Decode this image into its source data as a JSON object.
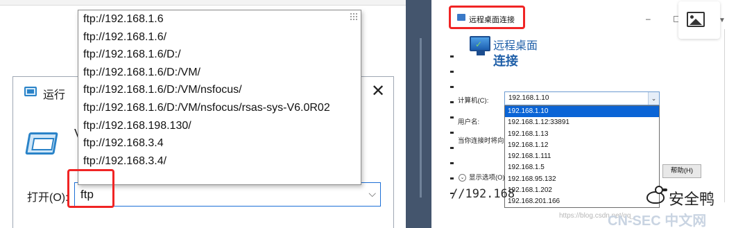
{
  "run_dialog": {
    "title": "运行",
    "close_glyph": "✕",
    "description_fragment": "V",
    "open_label": "打开(O):",
    "open_value": "ftp",
    "dropdown_glyph": "⌵",
    "history": [
      "ftp://192.168.1.6",
      "ftp://192.168.1.6/",
      "ftp://192.168.1.6/D:/",
      "ftp://192.168.1.6/D:/VM/",
      "ftp://192.168.1.6/D:/VM/nsfocus/",
      "ftp://192.168.1.6/D:/VM/nsfocus/rsas-sys-V6.0R02",
      "ftp://192.168.198.130/",
      "ftp://192.168.3.4",
      "ftp://192.168.3.4/"
    ]
  },
  "rdp_dialog": {
    "title": "远程桌面连接",
    "minimize_glyph": "–",
    "header_line1": "远程桌面",
    "header_line2": "连接",
    "computer_label": "计算机(C):",
    "username_label": "用户名:",
    "connect_note": "当你连接时将向",
    "computer_value": "192.168.1.10",
    "dropdown_glyph": "⌄",
    "computer_list": [
      "192.168.1.10",
      "192.168.1.12:33891",
      "192.168.1.13",
      "192.168.1.12",
      "192.168.1.111",
      "192.168.1.5",
      "192.168.95.132",
      "192.168.1.202",
      "192.168.201.166"
    ],
    "selected_index": 0,
    "options_label": "显示选项(O)",
    "options_glyph": "⌄",
    "help_button": "帮助(H)"
  },
  "background": {
    "ftp_fragment": "//192.168"
  },
  "watermark": "https://blog.csdn.net/qq_",
  "branding": {
    "account_name": "安全鸭",
    "site": "CN-SEC 中文网"
  },
  "colors": {
    "highlight_red": "#f02424",
    "selection_blue": "#0a64d6",
    "rdp_header_blue": "#1f5fa8"
  },
  "icons": [
    "run-app-icon",
    "close-icon",
    "chevron-down-icon",
    "rdp-app-icon",
    "image-icon",
    "duck-logo-icon"
  ]
}
